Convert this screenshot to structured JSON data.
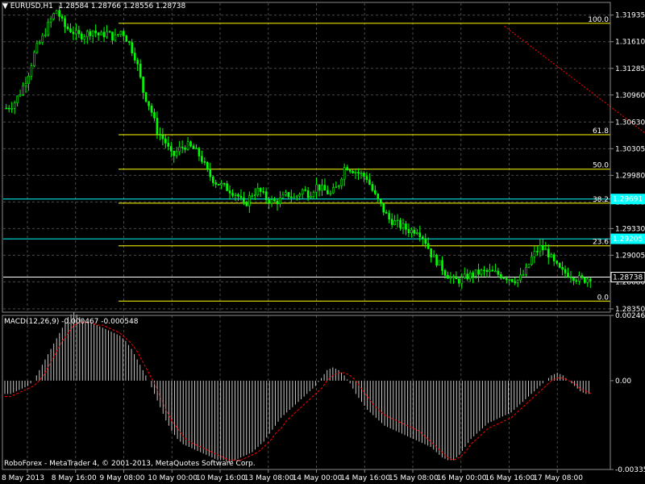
{
  "header": {
    "menu_arrow": "▼",
    "symbol": "EURUSD,H1",
    "ohlc": "1.28584 1.28766 1.28556 1.28738"
  },
  "macd_label": "MACD(12,26,9) -0.000467 -0.000548",
  "copyright": "RoboForex - MetaTrader 4, © 2001-2013, MetaQuotes Software Corp.",
  "colors": {
    "background": "#000000",
    "grid": "#4a4a4a",
    "frame": "#8c8c8c",
    "bull_candle": "#00ff00",
    "fibo": "#ffff00",
    "cyan_level": "#00ffff",
    "current_price": "#ffffff",
    "trend_line": "#ff0000",
    "histogram": "#c8c8c8",
    "signal_line": "#ff0000"
  },
  "chart_data": [
    {
      "type": "candlestick",
      "title": "EURUSD,H1",
      "ylim": [
        1.2831,
        1.3208
      ],
      "price_labels": [
        "1.31935",
        "1.31610",
        "1.31285",
        "1.30960",
        "1.30630",
        "1.30305",
        "1.29980",
        "1.29655",
        "1.29330",
        "1.29005",
        "1.28680",
        "1.28350"
      ],
      "time_labels": [
        "8 May 2013",
        "8 May 16:00",
        "9 May 08:00",
        "10 May 00:00",
        "10 May 16:00",
        "13 May 08:00",
        "14 May 00:00",
        "14 May 16:00",
        "15 May 08:00",
        "16 May 00:00",
        "16 May 16:00",
        "17 May 08:00"
      ],
      "close_path": [
        1.308,
        1.3085,
        1.31,
        1.312,
        1.315,
        1.3165,
        1.3185,
        1.32,
        1.318,
        1.3175,
        1.3168,
        1.317,
        1.3175,
        1.3168,
        1.3172,
        1.3165,
        1.3175,
        1.316,
        1.314,
        1.31,
        1.308,
        1.305,
        1.304,
        1.302,
        1.303,
        1.3035,
        1.303,
        1.302,
        1.3,
        1.299,
        1.2985,
        1.298,
        1.2975,
        1.296,
        1.2975,
        1.298,
        1.297,
        1.2965,
        1.2968,
        1.2975,
        1.297,
        1.298,
        1.2975,
        1.2985,
        1.298,
        1.2975,
        1.2985,
        1.301,
        1.3005,
        1.3,
        1.2995,
        1.2975,
        1.296,
        1.2945,
        1.294,
        1.2935,
        1.293,
        1.2932,
        1.292,
        1.29,
        1.289,
        1.2878,
        1.287,
        1.287,
        1.2875,
        1.2878,
        1.288,
        1.288,
        1.2878,
        1.2875,
        1.2872,
        1.287,
        1.288,
        1.29,
        1.291,
        1.2905,
        1.289,
        1.288,
        1.2878,
        1.2873,
        1.287,
        1.2874
      ],
      "fibonacci": [
        {
          "level": "100.0",
          "price": 1.31835
        },
        {
          "level": "61.8",
          "price": 1.30475
        },
        {
          "level": "50.0",
          "price": 1.30055
        },
        {
          "level": "38.2",
          "price": 1.2964
        },
        {
          "level": "23.6",
          "price": 1.2912
        },
        {
          "level": "0.0",
          "price": 1.28445
        }
      ],
      "horizontal_lines": [
        {
          "label": "1.29691",
          "price": 1.29691,
          "color": "cyan"
        },
        {
          "label": "1.29205",
          "price": 1.29205,
          "color": "cyan"
        },
        {
          "label": "1.28738",
          "price": 1.28738,
          "color": "white"
        }
      ],
      "trend_line": {
        "from": {
          "time_index": 9.9,
          "price": 1.318
        },
        "to": {
          "time_index": 23.5,
          "price": 1.2842
        }
      }
    },
    {
      "type": "bar",
      "title": "MACD(12,26,9)",
      "ylim": [
        -0.003352,
        0.002464
      ],
      "scale_labels": [
        "0.002464",
        "0.00",
        "-0.003352"
      ],
      "macd_values": [
        -0.0005,
        -0.0005,
        -0.0004,
        -0.0003,
        -0.0002,
        0.0,
        0.0004,
        0.0008,
        0.0012,
        0.0016,
        0.002,
        0.0024,
        0.0026,
        0.0024,
        0.0022,
        0.0022,
        0.0021,
        0.002,
        0.0019,
        0.0018,
        0.0017,
        0.0015,
        0.0012,
        0.0008,
        0.0004,
        0.0,
        -0.0005,
        -0.001,
        -0.0015,
        -0.0019,
        -0.0022,
        -0.0024,
        -0.0025,
        -0.0026,
        -0.0027,
        -0.0028,
        -0.0029,
        -0.003,
        -0.003,
        -0.0031,
        -0.003,
        -0.0029,
        -0.0028,
        -0.0027,
        -0.0025,
        -0.0023,
        -0.002,
        -0.0017,
        -0.0014,
        -0.0012,
        -0.001,
        -0.0008,
        -0.0006,
        -0.0004,
        -0.0002,
        0.0001,
        0.0004,
        0.0005,
        0.0004,
        0.0002,
        -0.0001,
        -0.0005,
        -0.0008,
        -0.0011,
        -0.0013,
        -0.0015,
        -0.0017,
        -0.0018,
        -0.0019,
        -0.002,
        -0.0021,
        -0.0022,
        -0.0023,
        -0.0024,
        -0.0025,
        -0.0027,
        -0.0029,
        -0.003,
        -0.003,
        -0.0028,
        -0.0025,
        -0.0022,
        -0.002,
        -0.0018,
        -0.0016,
        -0.0015,
        -0.0014,
        -0.0013,
        -0.0012,
        -0.001,
        -0.0008,
        -0.0006,
        -0.0004,
        -0.0002,
        0.0,
        0.0002,
        0.0003,
        0.0002,
        0.0,
        -0.0002,
        -0.0004,
        -0.0005,
        -0.0005
      ],
      "signal_values": [
        -0.0006,
        -0.0006,
        -0.0005,
        -0.0004,
        -0.0003,
        -0.0002,
        0.0,
        0.0003,
        0.0007,
        0.0011,
        0.0015,
        0.0018,
        0.0021,
        0.0022,
        0.0022,
        0.0022,
        0.0021,
        0.0021,
        0.002,
        0.0019,
        0.0018,
        0.0016,
        0.0014,
        0.0011,
        0.0007,
        0.0003,
        -0.0001,
        -0.0006,
        -0.0011,
        -0.0015,
        -0.0018,
        -0.0021,
        -0.0023,
        -0.0024,
        -0.0025,
        -0.0026,
        -0.0027,
        -0.0028,
        -0.0029,
        -0.003,
        -0.003,
        -0.003,
        -0.0029,
        -0.0028,
        -0.0027,
        -0.0025,
        -0.0023,
        -0.002,
        -0.0018,
        -0.0015,
        -0.0013,
        -0.0011,
        -0.0009,
        -0.0007,
        -0.0005,
        -0.0003,
        0.0,
        0.0002,
        0.0003,
        0.0003,
        0.0002,
        0.0,
        -0.0003,
        -0.0006,
        -0.0009,
        -0.0011,
        -0.0013,
        -0.0014,
        -0.0015,
        -0.0016,
        -0.0017,
        -0.0018,
        -0.0019,
        -0.0021,
        -0.0023,
        -0.0025,
        -0.0027,
        -0.0029,
        -0.003,
        -0.0029,
        -0.0027,
        -0.0024,
        -0.0022,
        -0.002,
        -0.0018,
        -0.0017,
        -0.0016,
        -0.0015,
        -0.0014,
        -0.0012,
        -0.001,
        -0.0008,
        -0.0006,
        -0.0004,
        -0.0002,
        0.0,
        0.0001,
        0.0001,
        0.0,
        -0.0001,
        -0.0003,
        -0.0004,
        -0.0005
      ]
    }
  ]
}
